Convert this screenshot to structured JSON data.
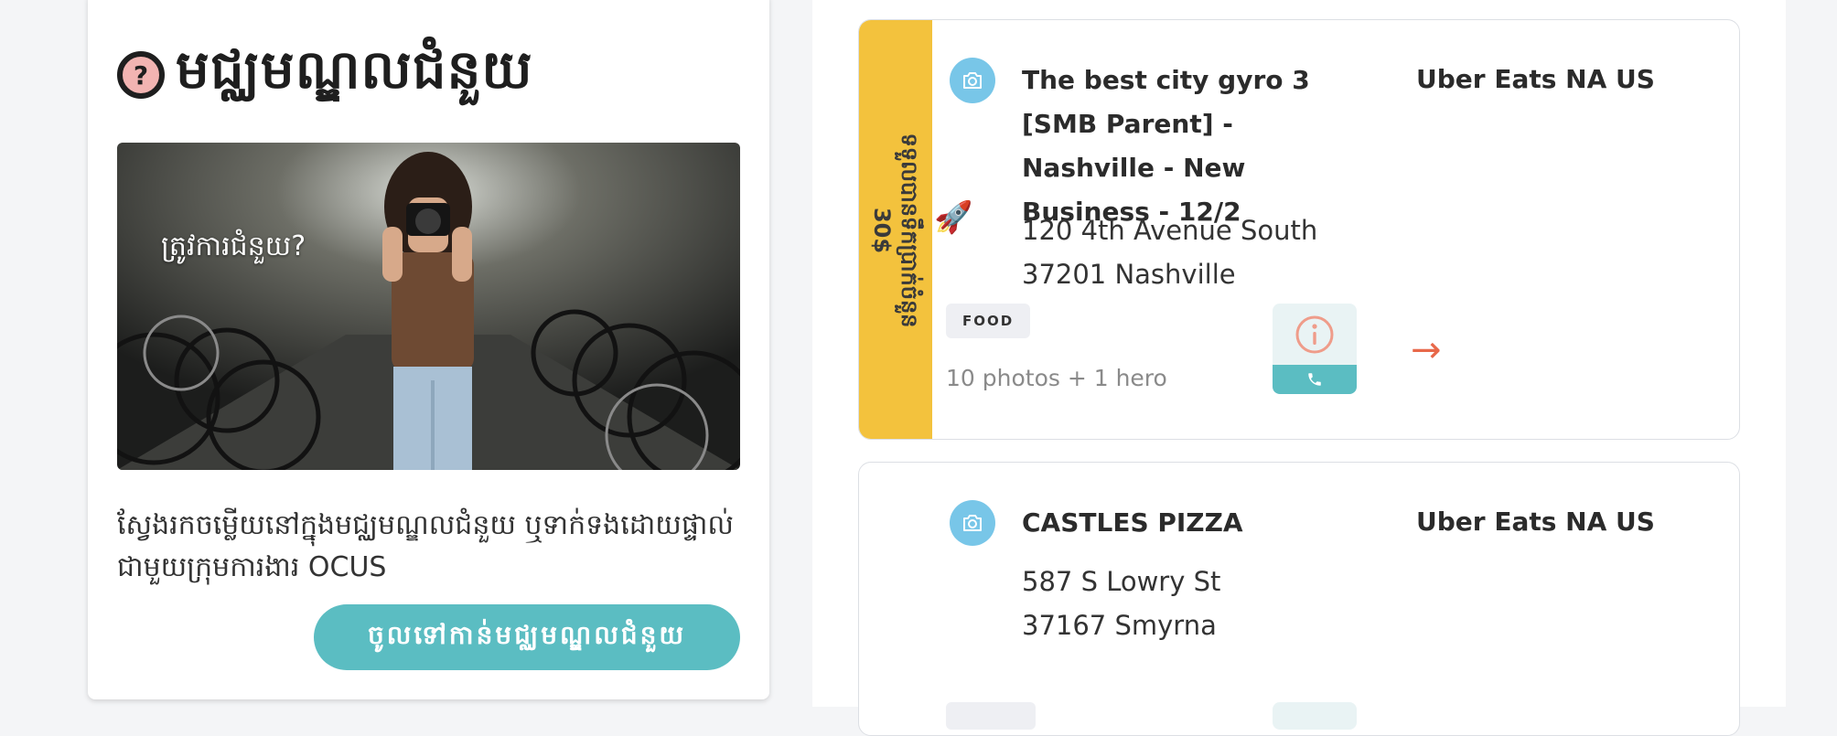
{
  "help_center": {
    "title": "មជ្ឈមណ្ឌលជំនួយ",
    "title_icon": "question-circle-icon",
    "image_caption": "ត្រូវការជំនួយ?",
    "description": "ស្វែងរកចម្លើយនៅក្នុងមជ្ឈមណ្ឌលជំនួយ ឬទាក់ទងដោយផ្ទាល់ជាមួយក្រុមការងារ OCUS",
    "button_label": "ចូលទៅកាន់មជ្ឈមណ្ឌលជំនួយ"
  },
  "listings": [
    {
      "ribbon_line1": "ទទួលបានទឹកប្រាក់ចំនួន",
      "ribbon_line2": "30$",
      "ribbon_icon": "rocket-icon",
      "title": "The best city gyro 3 [SMB Parent] - Nashville - New Business - 12/2",
      "platform": "Uber Eats NA US",
      "address_line1": "120 4th Avenue South",
      "address_line2": "37201 Nashville",
      "tag": "FOOD",
      "photos": "10 photos + 1 hero"
    },
    {
      "title": "CASTLES PIZZA",
      "platform": "Uber Eats NA US",
      "address_line1": "587 S Lowry St",
      "address_line2": "37167 Smyrna"
    }
  ],
  "colors": {
    "accent_teal": "#5bbdc2",
    "ribbon_yellow": "#f3c23d",
    "camera_blue": "#78c6e8",
    "arrow_orange": "#e8684a"
  }
}
